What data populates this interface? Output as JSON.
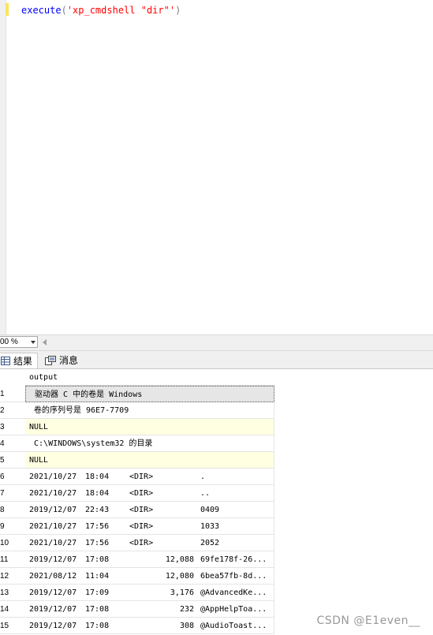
{
  "editor": {
    "code": {
      "func": "execute",
      "open_paren": "(",
      "arg": "'xp_cmdshell \"dir\"'",
      "close_paren": ")"
    }
  },
  "zoom": {
    "value": "00 %"
  },
  "tabs": {
    "results": "结果",
    "messages": "消息"
  },
  "grid": {
    "column_header": "output",
    "rows": [
      {
        "num": "1",
        "text": " 驱动器 C 中的卷是 Windows"
      },
      {
        "num": "2",
        "text": " 卷的序列号是 96E7-7709"
      },
      {
        "num": "3",
        "text": "NULL"
      },
      {
        "num": "4",
        "text": " C:\\WINDOWS\\system32 的目录"
      },
      {
        "num": "5",
        "text": "NULL"
      },
      {
        "num": "6",
        "date": "2021/10/27",
        "time": "18:04",
        "dir": "<DIR>",
        "size": "",
        "name": "."
      },
      {
        "num": "7",
        "date": "2021/10/27",
        "time": "18:04",
        "dir": "<DIR>",
        "size": "",
        "name": ".."
      },
      {
        "num": "8",
        "date": "2019/12/07",
        "time": "22:43",
        "dir": "<DIR>",
        "size": "",
        "name": "0409"
      },
      {
        "num": "9",
        "date": "2021/10/27",
        "time": "17:56",
        "dir": "<DIR>",
        "size": "",
        "name": "1033"
      },
      {
        "num": "10",
        "date": "2021/10/27",
        "time": "17:56",
        "dir": "<DIR>",
        "size": "",
        "name": "2052"
      },
      {
        "num": "11",
        "date": "2019/12/07",
        "time": "17:08",
        "dir": "",
        "size": "12,088",
        "name": "69fe178f-26..."
      },
      {
        "num": "12",
        "date": "2021/08/12",
        "time": "11:04",
        "dir": "",
        "size": "12,080",
        "name": "6bea57fb-8d..."
      },
      {
        "num": "13",
        "date": "2019/12/07",
        "time": "17:09",
        "dir": "",
        "size": "3,176",
        "name": "@AdvancedKe..."
      },
      {
        "num": "14",
        "date": "2019/12/07",
        "time": "17:08",
        "dir": "",
        "size": "232",
        "name": "@AppHelpToa..."
      },
      {
        "num": "15",
        "date": "2019/12/07",
        "time": "17:08",
        "dir": "",
        "size": "308",
        "name": "@AudioToast..."
      }
    ]
  },
  "watermark": "CSDN @E1even__",
  "colors": {
    "keyword": "#0000ff",
    "string": "#ff0000",
    "null_bg": "#ffffe1",
    "selected_bg": "#e6e6e6",
    "change_bar": "#ffe35a"
  },
  "icons": {
    "results_tab": "grid-icon",
    "messages_tab": "message-icon"
  }
}
